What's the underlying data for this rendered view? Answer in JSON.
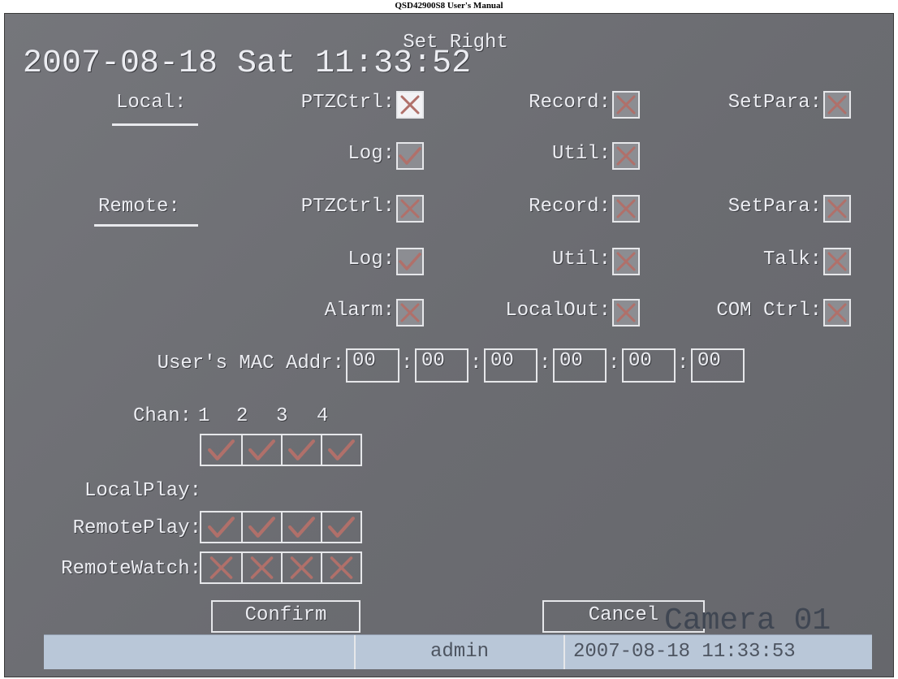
{
  "doc_header": "QSD42900S8 User's Manual",
  "osd": {
    "datetime": "2007-08-18 Sat 11:33:52",
    "camera": "Camera 01"
  },
  "dialog": {
    "title": "Set Right",
    "local": {
      "label": "Local:",
      "perms": [
        {
          "label": "PTZCtrl:",
          "state": "cross",
          "focused": true
        },
        {
          "label": "Record:",
          "state": "cross"
        },
        {
          "label": "SetPara:",
          "state": "cross"
        },
        {
          "label": "Log:",
          "state": "check"
        },
        {
          "label": "Util:",
          "state": "cross"
        }
      ]
    },
    "remote": {
      "label": "Remote:",
      "perms": [
        {
          "label": "PTZCtrl:",
          "state": "cross"
        },
        {
          "label": "Record:",
          "state": "cross"
        },
        {
          "label": "SetPara:",
          "state": "cross"
        },
        {
          "label": "Log:",
          "state": "check"
        },
        {
          "label": "Util:",
          "state": "cross"
        },
        {
          "label": "Talk:",
          "state": "cross"
        },
        {
          "label": "Alarm:",
          "state": "cross"
        },
        {
          "label": "LocalOut:",
          "state": "cross"
        },
        {
          "label": "COM Ctrl:",
          "state": "cross"
        }
      ]
    },
    "mac": {
      "label": "User's MAC Addr:",
      "octets": [
        "00",
        "00",
        "00",
        "00",
        "00",
        "00"
      ],
      "separator": ":"
    },
    "chan": {
      "label": "Chan:",
      "numbers": [
        "1",
        "2",
        "3",
        "4"
      ]
    },
    "rows": [
      {
        "label": "LocalPlay:",
        "states": [
          "check",
          "check",
          "check",
          "check"
        ]
      },
      {
        "label": "RemotePlay:",
        "states": [
          "check",
          "check",
          "check",
          "check"
        ]
      },
      {
        "label": "RemoteWatch:",
        "states": [
          "cross",
          "cross",
          "cross",
          "cross"
        ]
      }
    ],
    "confirm_label": "Confirm",
    "cancel_label": "Cancel"
  },
  "status_bar": {
    "user": "admin",
    "time": "2007-08-18 11:33:53"
  },
  "colors": {
    "mark": "#b0706a",
    "frame": "#e6e7ea",
    "screen": "#6e6f74",
    "status": "#b9c7d8"
  }
}
